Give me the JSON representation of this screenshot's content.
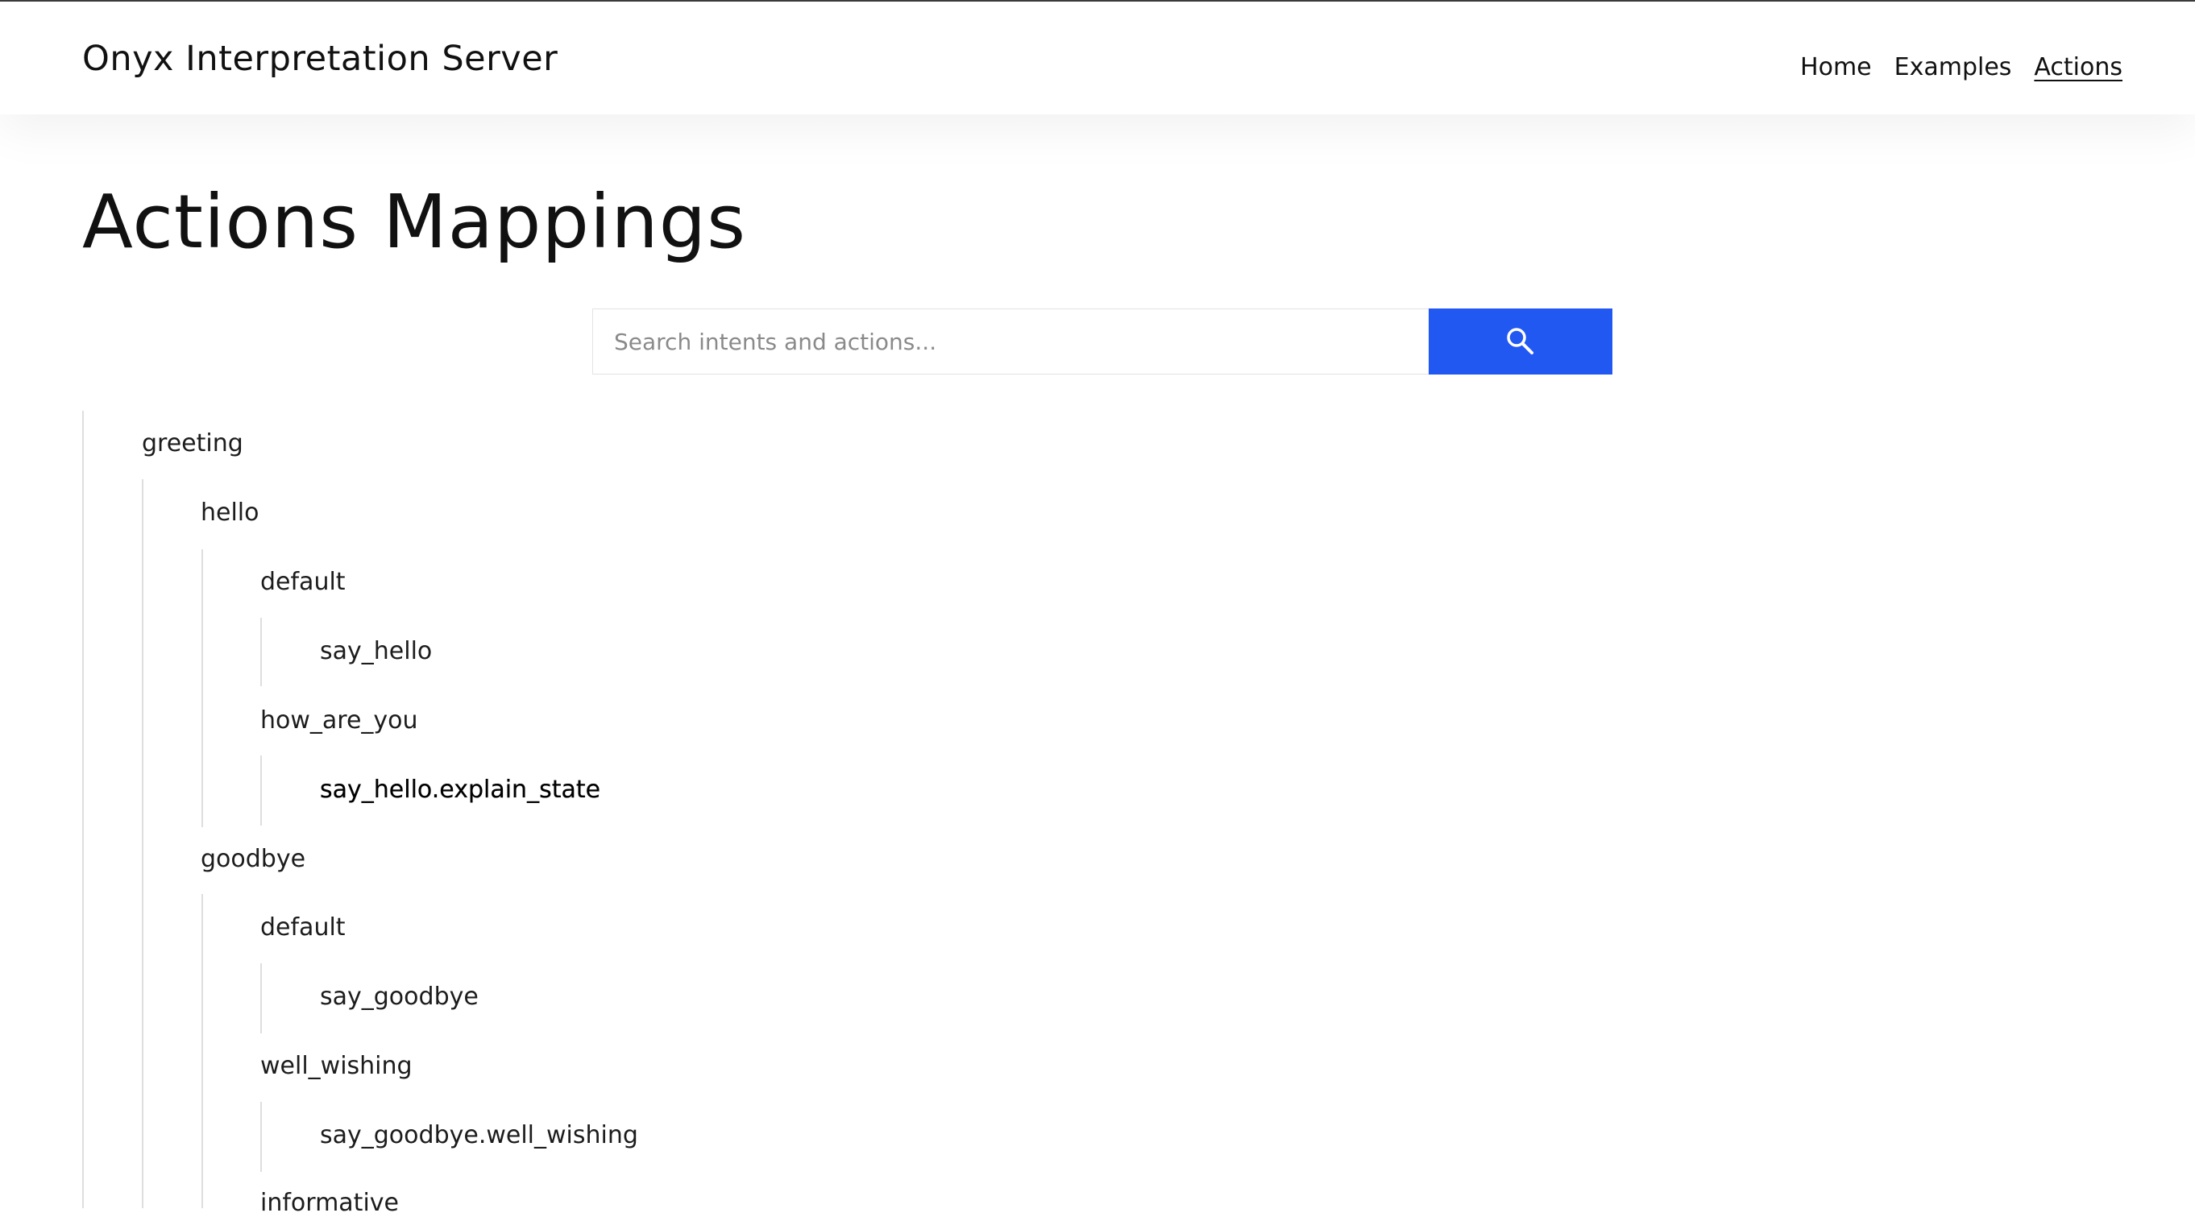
{
  "header": {
    "brand": "Onyx Interpretation Server",
    "nav": [
      {
        "label": "Home",
        "active": false
      },
      {
        "label": "Examples",
        "active": false
      },
      {
        "label": "Actions",
        "active": true
      }
    ]
  },
  "main": {
    "title": "Actions Mappings",
    "search": {
      "placeholder": "Search intents and actions...",
      "value": "",
      "button_icon": "search-icon",
      "button_color": "#2258f2"
    },
    "tree": {
      "label": "greeting",
      "children": [
        {
          "label": "hello",
          "children": [
            {
              "label": "default",
              "children": [
                {
                  "label": "say_hello"
                }
              ]
            },
            {
              "label": "how_are_you",
              "children": [
                {
                  "label": "say_hello.explain_state"
                }
              ]
            }
          ]
        },
        {
          "label": "goodbye",
          "children": [
            {
              "label": "default",
              "children": [
                {
                  "label": "say_goodbye"
                }
              ]
            },
            {
              "label": "well_wishing",
              "children": [
                {
                  "label": "say_goodbye.well_wishing"
                }
              ]
            },
            {
              "label": "informative"
            }
          ]
        }
      ]
    }
  }
}
